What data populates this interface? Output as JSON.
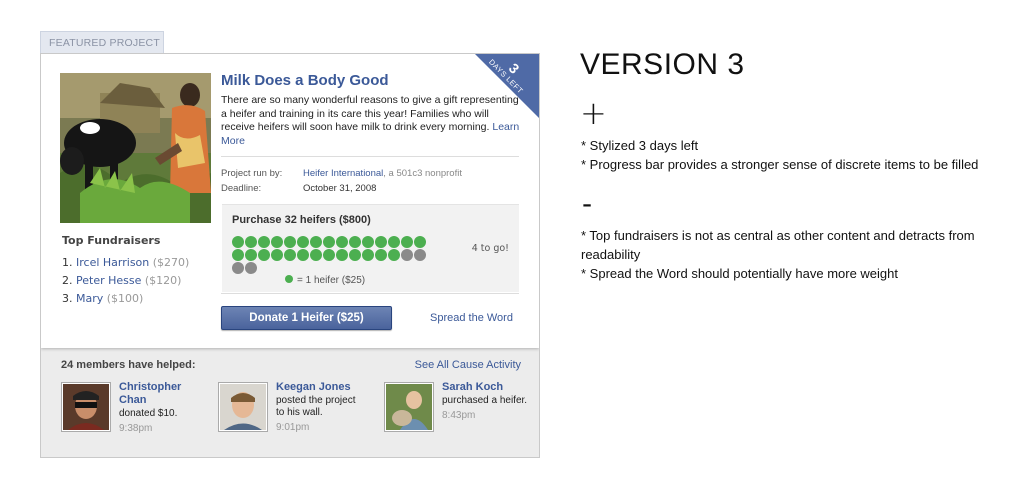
{
  "tab": {
    "label": "FEATURED PROJECT"
  },
  "ribbon": {
    "number": "3",
    "text": "DAYS LEFT"
  },
  "project": {
    "title": "Milk Does a Body Good",
    "description": "There are so many wonderful reasons to give a gift representing a heifer and training in its care this year! Families who will receive heifers will soon have milk to drink every morning.",
    "learn_more": "Learn More",
    "run_by_label": "Project run by:",
    "run_by_org": "Heifer International",
    "run_by_suffix": ", a 501c3 nonprofit",
    "deadline_label": "Deadline:",
    "deadline_value": "October 31, 2008"
  },
  "progress": {
    "title": "Purchase 32 heifers ($800)",
    "total": 32,
    "filled": 28,
    "to_go": "4 to go!",
    "legend": "= 1 heifer ($25)",
    "filled_color": "#4caf50",
    "empty_color": "#8a8a8a"
  },
  "actions": {
    "donate_label": "Donate 1 Heifer ($25)",
    "spread_label": "Spread the Word"
  },
  "fundraisers": {
    "title": "Top Fundraisers",
    "items": [
      {
        "rank": "1.",
        "name": "Ircel Harrison",
        "amount": "($270)"
      },
      {
        "rank": "2.",
        "name": "Peter Hesse",
        "amount": "($120)"
      },
      {
        "rank": "3.",
        "name": "Mary",
        "amount": "($100)"
      }
    ]
  },
  "activity": {
    "title": "24 members have helped:",
    "see_all": "See All Cause Activity",
    "members": [
      {
        "name": "Christopher Chan",
        "action": "donated $10.",
        "time": "9:38pm",
        "avatar": "person-sunglasses-avatar"
      },
      {
        "name": "Keegan Jones",
        "action": "posted the project to his wall.",
        "time": "9:01pm",
        "avatar": "person-young-man-avatar"
      },
      {
        "name": "Sarah Koch",
        "action": "purchased a heifer.",
        "time": "8:43pm",
        "avatar": "person-with-animal-avatar"
      }
    ]
  },
  "notes": {
    "version": "VERSION 3",
    "plus": "+",
    "minus": "-",
    "pros": [
      "* Stylized 3 days left",
      "* Progress bar provides a stronger sense of discrete items to be filled"
    ],
    "cons": [
      "* Top fundraisers is not as central as other content and detracts from readability",
      "* Spread the Word should potentially have more weight"
    ]
  },
  "colors": {
    "link": "#3b5998",
    "button": "#4a639c",
    "ribbon": "#4f6aa6"
  }
}
